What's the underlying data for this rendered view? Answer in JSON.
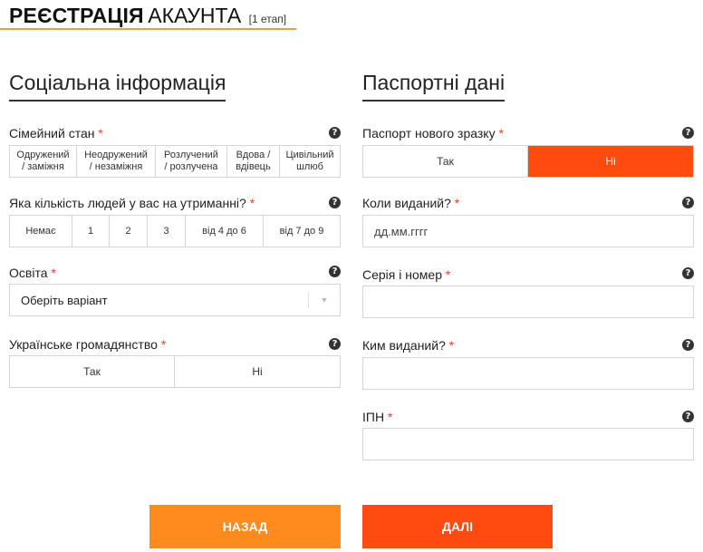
{
  "header": {
    "title_bold": "РЕЄСТРАЦІЯ",
    "title_rest": "АКАУНТА",
    "step": "[1 етап]"
  },
  "colors": {
    "accent": "#ff4a10",
    "back_button": "#ff8a1e",
    "header_rule": "#f0a030",
    "required": "#e8431f"
  },
  "social": {
    "title": "Соціальна інформація",
    "marital": {
      "label": "Сімейний стан",
      "required": "*",
      "options": [
        {
          "l1": "Одружений",
          "l2": "/ заміжня"
        },
        {
          "l1": "Неодружений",
          "l2": "/ незаміжня"
        },
        {
          "l1": "Розлучений",
          "l2": "/ розлучена"
        },
        {
          "l1": "Вдова /",
          "l2": "вдівець"
        },
        {
          "l1": "Цивільний",
          "l2": "шлюб"
        }
      ]
    },
    "dependents": {
      "label": "Яка кількість людей у вас на утриманні?",
      "required": "*",
      "options": [
        "Немає",
        "1",
        "2",
        "3",
        "від 4 до 6",
        "від 7 до 9"
      ]
    },
    "education": {
      "label": "Освіта",
      "required": "*",
      "value": "Оберіть варіант",
      "icon": "caret-down-icon"
    },
    "citizenship": {
      "label": "Українське громадянство",
      "required": "*",
      "options": [
        "Так",
        "Ні"
      ]
    }
  },
  "passport": {
    "title": "Паспортні дані",
    "new_format": {
      "label": "Паспорт нового зразку",
      "required": "*",
      "options": [
        "Так",
        "Ні"
      ],
      "selected": "Ні"
    },
    "issued_date": {
      "label": "Коли виданий?",
      "required": "*",
      "placeholder": "дд.мм.гггг"
    },
    "series_number": {
      "label": "Серія і номер",
      "required": "*"
    },
    "issued_by": {
      "label": "Ким виданий?",
      "required": "*"
    },
    "ipn": {
      "label": "ІПН",
      "required": "*"
    }
  },
  "help_icon": "?",
  "buttons": {
    "back": "НАЗАД",
    "next": "ДАЛІ"
  }
}
